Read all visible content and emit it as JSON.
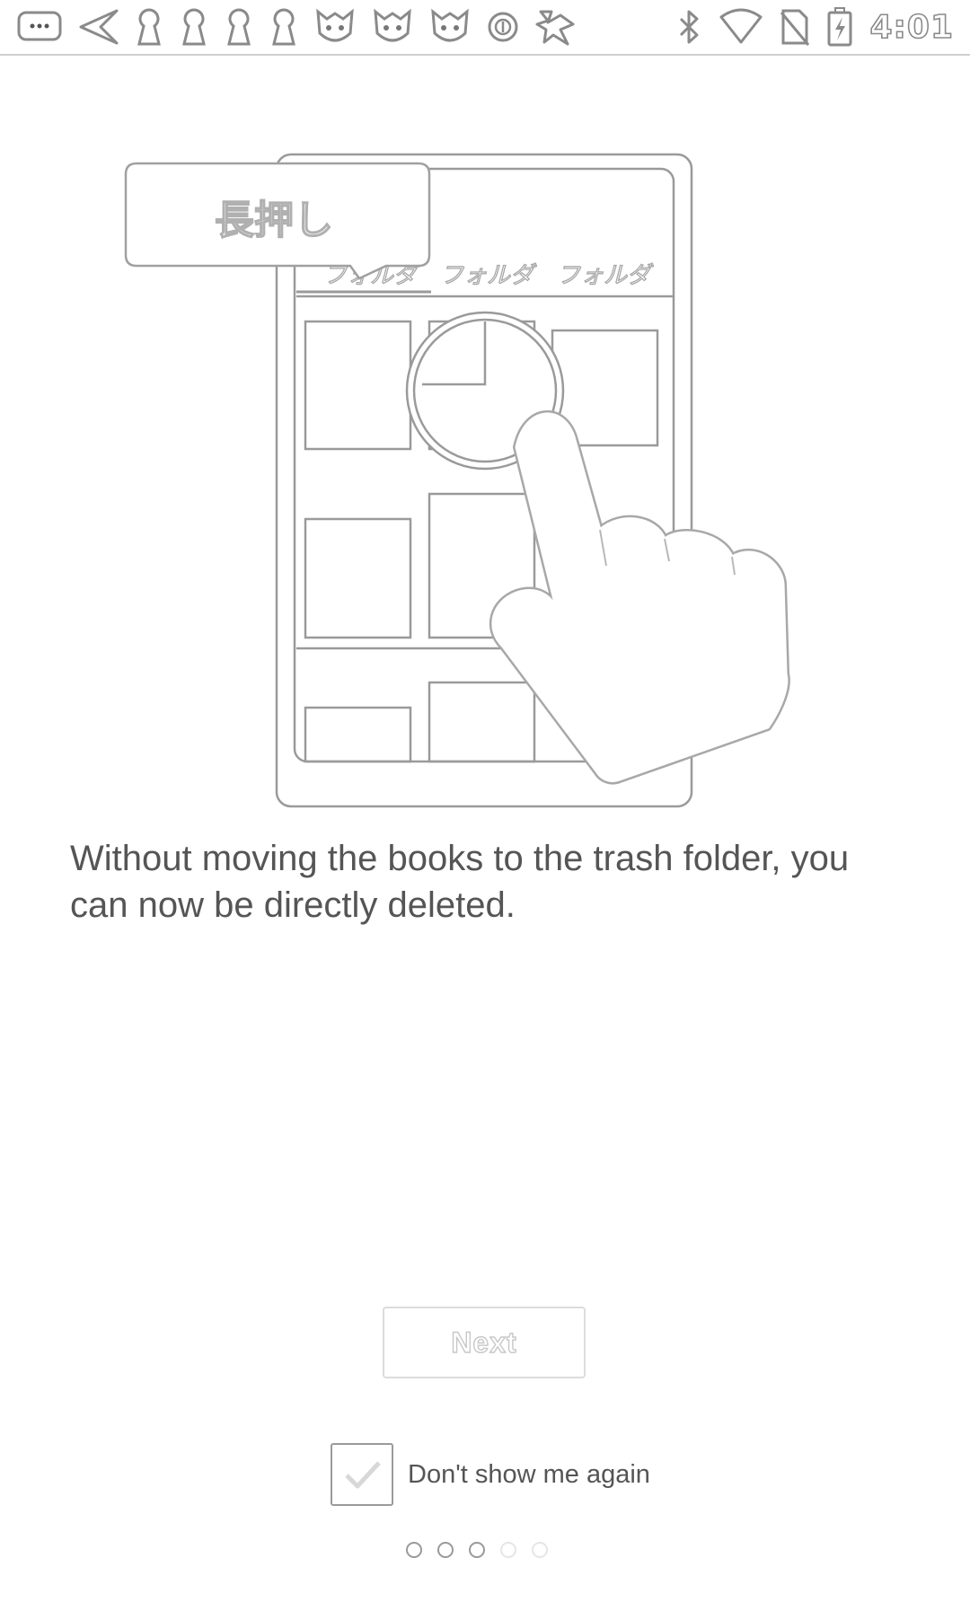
{
  "status_bar": {
    "time": "4:01",
    "left_icons": [
      "chat-bubble-icon",
      "back-arrow-icon",
      "keyhole-icon",
      "keyhole-icon",
      "keyhole-icon",
      "keyhole-icon",
      "cat-face-icon",
      "cat-face-icon",
      "cat-face-icon",
      "circle-badge-icon",
      "app-notification-icon"
    ],
    "right_icons": [
      "bluetooth-icon",
      "wifi-icon",
      "no-sim-icon",
      "battery-charging-icon"
    ]
  },
  "illustration": {
    "tooltip_label": "長押し",
    "tabs": [
      "フォルダ",
      "フォルダ",
      "フォルダ"
    ]
  },
  "message": "Without moving the books to the trash folder, you can now be directly deleted.",
  "next_button": {
    "label": "Next"
  },
  "dont_show_again": {
    "label": "Don't show me again",
    "checked": true
  },
  "pager": {
    "total": 5,
    "current": 3
  }
}
